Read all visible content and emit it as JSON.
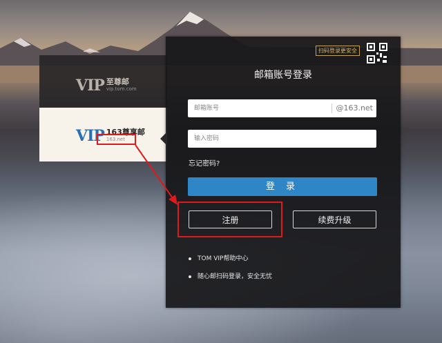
{
  "left_panel": {
    "brand1": {
      "vip": "VIP",
      "name": "至尊邮",
      "domain": "vip.tom.com"
    },
    "brand2": {
      "vip": "VIP",
      "name": "163尊享邮",
      "domain": "163.net"
    }
  },
  "login": {
    "qr_tip": "扫码登录更安全",
    "title": "邮箱账号登录",
    "account_placeholder": "邮箱账号",
    "account_suffix": "@163.net",
    "password_placeholder": "输入密码",
    "forgot": "忘记密码?",
    "login_button": "登 录",
    "register_button": "注册",
    "renew_button": "续费升级",
    "help_links": [
      "TOM VIP帮助中心",
      "随心邮扫码登录，安全无忧"
    ]
  },
  "colors": {
    "accent": "#2f86c7",
    "highlight": "#e0191b",
    "gold": "#c9a25a"
  }
}
